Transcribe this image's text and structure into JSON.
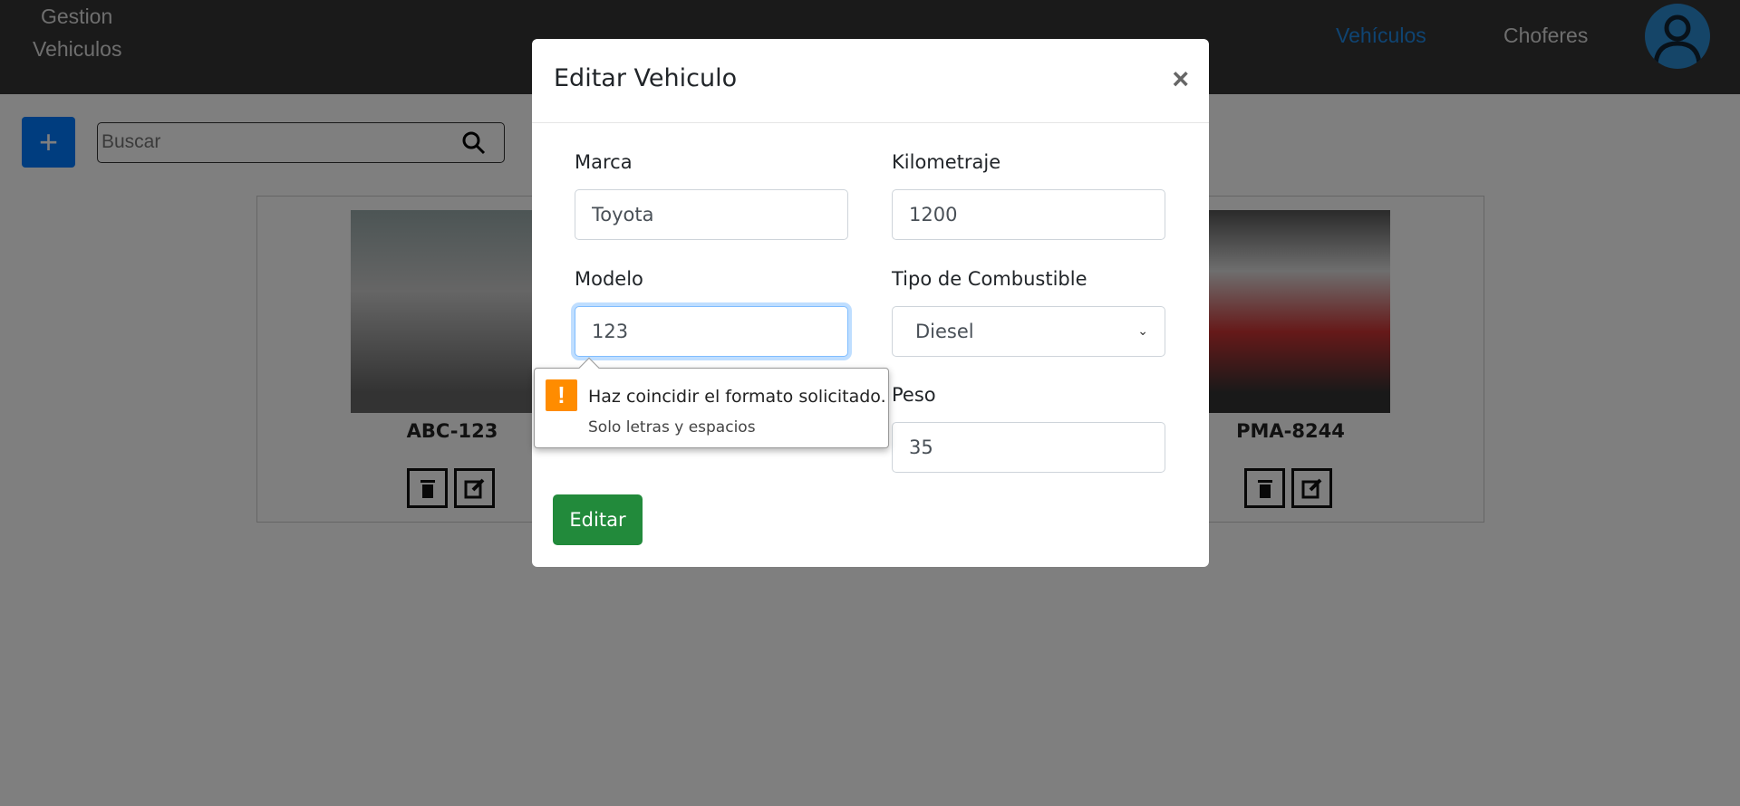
{
  "navbar": {
    "brand_line1": "Gestion",
    "brand_line2": "Vehiculos",
    "links": [
      {
        "label": "Vehículos",
        "active": true
      },
      {
        "label": "Choferes",
        "active": false
      }
    ],
    "active_color": "#1e88e5"
  },
  "toolbar": {
    "add_label": "+",
    "search_placeholder": "Buscar"
  },
  "vehicles": [
    {
      "plate": "ABC-123"
    },
    {
      "plate": "PMA-8244"
    }
  ],
  "modal": {
    "title": "Editar Vehiculo",
    "close_label": "×",
    "fields": {
      "marca": {
        "label": "Marca",
        "value": "Toyota"
      },
      "kilometraje": {
        "label": "Kilometraje",
        "value": "1200"
      },
      "modelo": {
        "label": "Modelo",
        "value": "123"
      },
      "combustible": {
        "label": "Tipo de Combustible",
        "value": "Diesel"
      },
      "peso": {
        "label": "Peso",
        "value": "35"
      }
    },
    "submit_label": "Editar"
  },
  "validation_tooltip": {
    "title": "Haz coincidir el formato solicitado.",
    "message": "Solo letras y espacios"
  }
}
